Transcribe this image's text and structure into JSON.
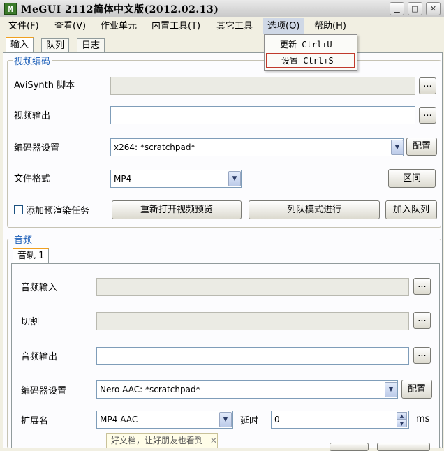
{
  "window": {
    "title": "MeGUI 2112简体中文版(2012.02.13)",
    "app_icon": "M"
  },
  "menu": {
    "items": [
      {
        "label": "文件(F)"
      },
      {
        "label": "查看(V)"
      },
      {
        "label": "作业单元"
      },
      {
        "label": "内置工具(T)"
      },
      {
        "label": "其它工具"
      },
      {
        "label": "选项(O)"
      },
      {
        "label": "帮助(H)"
      }
    ],
    "dropdown": [
      {
        "label": "更新 Ctrl+U"
      },
      {
        "label": "设置 Ctrl+S"
      }
    ]
  },
  "tabs": [
    {
      "label": "输入"
    },
    {
      "label": "队列"
    },
    {
      "label": "日志"
    }
  ],
  "video": {
    "group_title": "视频编码",
    "avisynth_label": "AviSynth 脚本",
    "avisynth_value": "",
    "output_label": "视频输出",
    "output_value": "",
    "encoder_label": "编码器设置",
    "encoder_value": "x264: *scratchpad*",
    "config_button": "配置",
    "format_label": "文件格式",
    "format_value": "MP4",
    "range_button": "区间",
    "add_prerender_label": "添加预渲染任务",
    "reopen_preview_button": "重新打开视频预览",
    "queue_mode_button": "列队模式进行",
    "add_queue_button": "加入队列",
    "browse_label": "..."
  },
  "audio": {
    "group_title": "音频",
    "track_tab": "音轨 1",
    "input_label": "音频输入",
    "input_value": "",
    "cut_label": "切割",
    "cut_value": "",
    "output_label": "音频输出",
    "output_value": "",
    "encoder_label": "编码器设置",
    "encoder_value": "Nero AAC: *scratchpad*",
    "config_button": "配置",
    "ext_label": "扩展名",
    "ext_value": "MP4-AAC",
    "delay_label": "延时",
    "delay_value": "0",
    "delay_unit": "ms",
    "browse_label": "..."
  },
  "tooltip": {
    "text": "好文档，让好朋友也看到",
    "close": "✕"
  },
  "colors": {
    "accent": "#1d5fb8",
    "highlight_border": "#c0392b",
    "window_bg": "#f1efe2"
  }
}
